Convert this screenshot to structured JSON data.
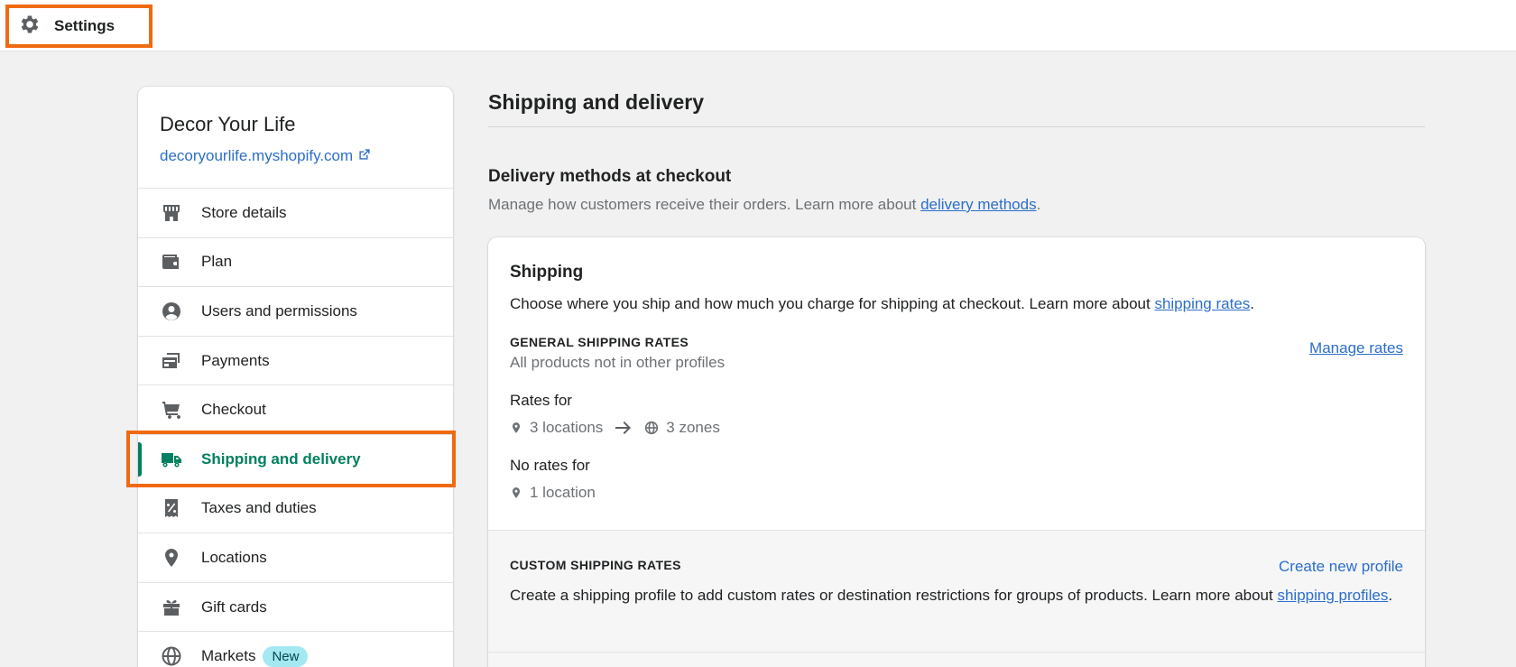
{
  "topbar": {
    "settings_label": "Settings"
  },
  "sidebar": {
    "store_name": "Decor Your Life",
    "store_url": "decoryourlife.myshopify.com",
    "items": [
      {
        "label": "Store details",
        "icon": "store-icon"
      },
      {
        "label": "Plan",
        "icon": "wallet-icon"
      },
      {
        "label": "Users and permissions",
        "icon": "user-circle-icon"
      },
      {
        "label": "Payments",
        "icon": "payments-icon"
      },
      {
        "label": "Checkout",
        "icon": "cart-icon"
      },
      {
        "label": "Shipping and delivery",
        "icon": "truck-icon",
        "active": true
      },
      {
        "label": "Taxes and duties",
        "icon": "receipt-percent-icon"
      },
      {
        "label": "Locations",
        "icon": "location-pin-icon"
      },
      {
        "label": "Gift cards",
        "icon": "gift-icon"
      },
      {
        "label": "Markets",
        "icon": "globe-icon",
        "badge": "New"
      }
    ]
  },
  "main": {
    "page_title": "Shipping and delivery",
    "delivery_section": {
      "title": "Delivery methods at checkout",
      "desc_prefix": "Manage how customers receive their orders. Learn more about ",
      "desc_link": "delivery methods",
      "desc_suffix": "."
    },
    "shipping_card": {
      "heading": "Shipping",
      "desc_prefix": "Choose where you ship and how much you charge for shipping at checkout. Learn more about ",
      "desc_link": "shipping rates",
      "desc_suffix": ".",
      "general": {
        "title": "GENERAL SHIPPING RATES",
        "subtitle": "All products not in other profiles",
        "manage_link": "Manage rates",
        "rates_for_label": "Rates for",
        "locations": "3 locations",
        "zones": "3 zones",
        "no_rates_label": "No rates for",
        "no_rates_locations": "1 location"
      },
      "custom": {
        "title": "CUSTOM SHIPPING RATES",
        "create_link": "Create new profile",
        "desc_prefix": "Create a shipping profile to add custom rates or destination restrictions for groups of products. Learn more about ",
        "desc_link": "shipping profiles",
        "desc_suffix": "."
      }
    }
  },
  "colors": {
    "accent_green": "#008060",
    "link_blue": "#2c6ecb",
    "highlight_orange": "#f06a12",
    "badge_bg": "#a4e8f2"
  }
}
